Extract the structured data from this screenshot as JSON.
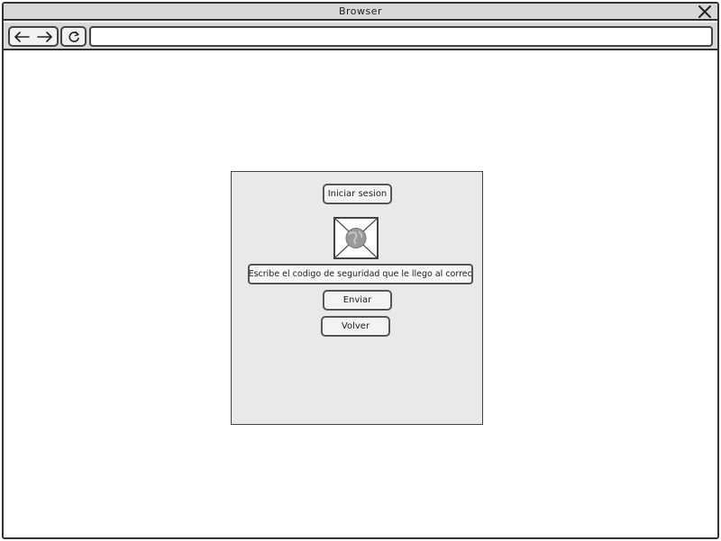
{
  "window": {
    "title": "Browser",
    "address": ""
  },
  "icons": {
    "close": "close-icon",
    "back": "arrow-left-icon",
    "forward": "arrow-right-icon",
    "reload": "reload-icon",
    "image": "image-placeholder-icon"
  },
  "panel": {
    "login_button": "Iniciar sesion",
    "code_field": "Escribe el codigo de seguridad que le llego al correo",
    "send_button": "Enviar",
    "back_button": "Volver"
  },
  "colors": {
    "chrome": "#d8d8d8",
    "panel": "#e9e9e9",
    "border": "#333333"
  }
}
